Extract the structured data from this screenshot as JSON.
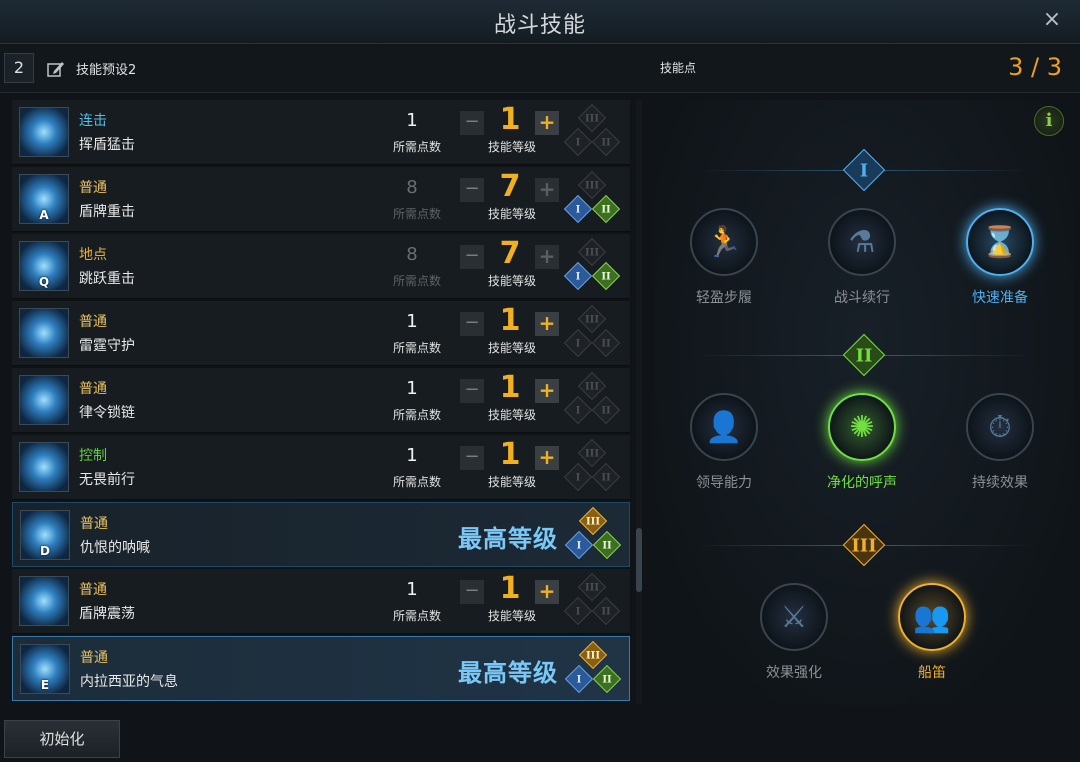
{
  "window": {
    "title": "战斗技能",
    "close_icon": "×"
  },
  "preset": {
    "number": "2",
    "name": "技能预设2",
    "points_label": "技能点",
    "points_value": "3 / 3"
  },
  "labels": {
    "cost": "所需点数",
    "level": "技能等级",
    "max_level": "最高等级",
    "minus": "−",
    "plus": "+",
    "tier1": "I",
    "tier2": "II",
    "tier3": "III"
  },
  "skills": [
    {
      "type": "连击",
      "type_color": "#4fc0e8",
      "name": "挥盾猛击",
      "key": "",
      "cost": "1",
      "level": "1",
      "maxed": false,
      "plus_enabled": true,
      "tiers": [
        false,
        false,
        false
      ]
    },
    {
      "type": "普通",
      "type_color": "#e8c060",
      "name": "盾牌重击",
      "key": "A",
      "cost": "8",
      "level": "7",
      "maxed": false,
      "plus_enabled": false,
      "tiers": [
        true,
        true,
        false
      ]
    },
    {
      "type": "地点",
      "type_color": "#e8b030",
      "name": "跳跃重击",
      "key": "Q",
      "cost": "8",
      "level": "7",
      "maxed": false,
      "plus_enabled": false,
      "tiers": [
        true,
        true,
        false
      ]
    },
    {
      "type": "普通",
      "type_color": "#e8c060",
      "name": "雷霆守护",
      "key": "",
      "cost": "1",
      "level": "1",
      "maxed": false,
      "plus_enabled": true,
      "tiers": [
        false,
        false,
        false
      ]
    },
    {
      "type": "普通",
      "type_color": "#e8c060",
      "name": "律令锁链",
      "key": "",
      "cost": "1",
      "level": "1",
      "maxed": false,
      "plus_enabled": true,
      "tiers": [
        false,
        false,
        false
      ]
    },
    {
      "type": "控制",
      "type_color": "#60d040",
      "name": "无畏前行",
      "key": "",
      "cost": "1",
      "level": "1",
      "maxed": false,
      "plus_enabled": true,
      "tiers": [
        false,
        false,
        false
      ]
    },
    {
      "type": "普通",
      "type_color": "#e8c060",
      "name": "仇恨的呐喊",
      "key": "D",
      "cost": "",
      "level": "",
      "maxed": true,
      "plus_enabled": false,
      "tiers": [
        true,
        true,
        true
      ]
    },
    {
      "type": "普通",
      "type_color": "#e8c060",
      "name": "盾牌震荡",
      "key": "",
      "cost": "1",
      "level": "1",
      "maxed": false,
      "plus_enabled": true,
      "tiers": [
        false,
        false,
        false
      ]
    },
    {
      "type": "普通",
      "type_color": "#e8c060",
      "name": "内拉西亚的气息",
      "key": "E",
      "cost": "",
      "level": "",
      "maxed": true,
      "plus_enabled": false,
      "tiers": [
        true,
        true,
        true
      ]
    }
  ],
  "tripods": {
    "tier1": [
      {
        "name": "轻盈步履",
        "icon": "running-man-icon",
        "active": false
      },
      {
        "name": "战斗续行",
        "icon": "potion-flask-icon",
        "active": false
      },
      {
        "name": "快速准备",
        "icon": "hourglass-icon",
        "active": true
      }
    ],
    "tier2": [
      {
        "name": "领导能力",
        "icon": "person-silhouette-icon",
        "active": false
      },
      {
        "name": "净化的呼声",
        "icon": "energy-orb-icon",
        "active": true
      },
      {
        "name": "持续效果",
        "icon": "stopwatch-icon",
        "active": false
      }
    ],
    "tier3": [
      {
        "name": "效果强化",
        "icon": "sword-slash-icon",
        "active": false
      },
      {
        "name": "船笛",
        "icon": "crowd-icon",
        "active": true
      }
    ]
  },
  "colors": {
    "tier1": "#4fb0f0",
    "tier2": "#70e040",
    "tier3": "#f0b030",
    "points": "#f0a020"
  },
  "reset_button": "初始化"
}
